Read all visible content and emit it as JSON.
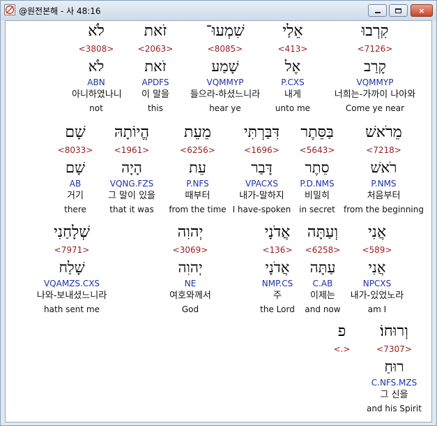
{
  "window": {
    "title": "@원전본해 - 사 48:16",
    "minimize_glyph": "min-icon",
    "maximize_glyph": "max-icon",
    "close_glyph": "×"
  },
  "words": [
    {
      "heb": "קִרְבוּ",
      "strong": "<7126>",
      "root": "קָרַב",
      "morph": "VQMMYP",
      "kor": "너희는-가까이 나아와",
      "eng": "Come ye near"
    },
    {
      "heb": "אֵלַי",
      "strong": "<413>",
      "root": "אֶל",
      "morph": "P.CXS",
      "kor": "내게",
      "eng": "unto me"
    },
    {
      "heb": "שִׁמְעוּ־",
      "strong": "<8085>",
      "root": "שָׁמַע",
      "morph": "VQMMYP",
      "kor": "들으라-하셨느니라",
      "eng": "hear ye"
    },
    {
      "heb": "זֹאת",
      "strong": "<2063>",
      "root": "זֹאת",
      "morph": "APDFS",
      "kor": "이 말을",
      "eng": "this"
    },
    {
      "heb": "לֹא",
      "strong": "<3808>",
      "root": "לֹא",
      "morph": "ABN",
      "kor": "아니하였나니",
      "eng": "not"
    },
    {
      "heb": "מֵרֹאשׁ",
      "strong": "<7218>",
      "root": "רֹאשׁ",
      "morph": "P.NMS",
      "kor": "처음부터",
      "eng": "from the beginning"
    },
    {
      "heb": "בַּסֵּתֶר",
      "strong": "<5643>",
      "root": "סֵתֶר",
      "morph": "P.D.NMS",
      "kor": "비밀히",
      "eng": "in secret"
    },
    {
      "heb": "דִּבַּרְתִּי",
      "strong": "<1696>",
      "root": "דָּבַר",
      "morph": "VPACXS",
      "kor": "내가-말하지",
      "eng": "I have-spoken"
    },
    {
      "heb": "מֵעֵת",
      "strong": "<6256>",
      "root": "עֵת",
      "morph": "P.NFS",
      "kor": "때부터",
      "eng": "from the time"
    },
    {
      "heb": "הֱיוֹתָהּ",
      "strong": "<1961>",
      "root": "הָיָה",
      "morph": "VQNG.FZS",
      "kor": "그 말이 있을",
      "eng": "that it was"
    },
    {
      "heb": "שָׁם",
      "strong": "<8033>",
      "root": "שָׁם",
      "morph": "AB",
      "kor": "거기",
      "eng": "there"
    },
    {
      "heb": "אֲנִי",
      "strong": "<589>",
      "root": "אֲנִי",
      "morph": "NPCXS",
      "kor": "내가-있었노라",
      "eng": "am I"
    },
    {
      "heb": "וְעַתָּה",
      "strong": "<6258>",
      "root": "עַתָּה",
      "morph": "C.AB",
      "kor": "이제는",
      "eng": "and now"
    },
    {
      "heb": "אֲדֹנָי",
      "strong": "<136>",
      "root": "אֲדֹנָי",
      "morph": "NMP.CS",
      "kor": "주",
      "eng": "the Lord"
    },
    {
      "heb": "יְהוִה",
      "strong": "<3069>",
      "root": "יְהוִה",
      "morph": "NE",
      "kor": "여호와께서",
      "eng": "God"
    },
    {
      "heb": "שְׁלָחַנִי",
      "strong": "<7971>",
      "root": "שָׁלַח",
      "morph": "VQAMZS.CXS",
      "kor": "나와-보내셨느니라",
      "eng": "hath sent me"
    },
    {
      "heb": "וְרוּחוֹ׃",
      "strong": "<7307>",
      "root": "רוּחַ",
      "morph": "C.NFS.MZS",
      "kor": "그 신을",
      "eng": "and his Spirit"
    },
    {
      "heb": "פ",
      "strong": "<.>",
      "root": "",
      "morph": "",
      "kor": "",
      "eng": ""
    }
  ]
}
